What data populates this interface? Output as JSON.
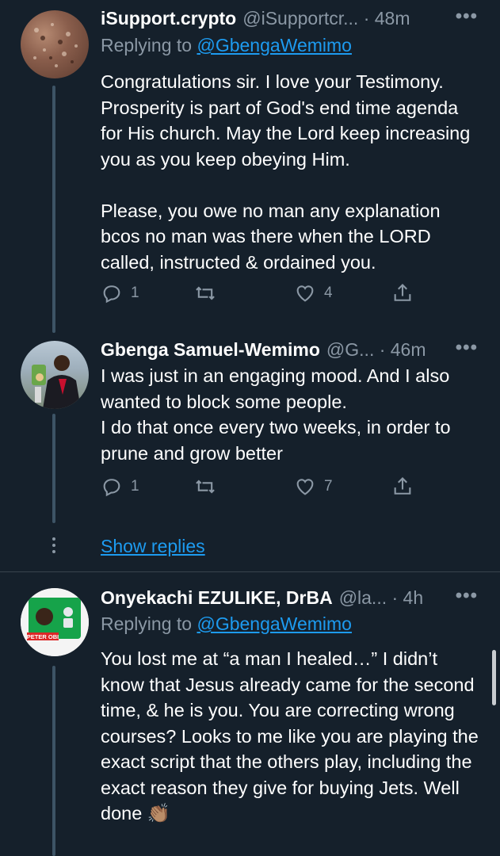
{
  "tweets": [
    {
      "name": "iSupport.crypto",
      "handle": "@iSupportcr... · 48m",
      "more": "•••",
      "replying_prefix": "Replying to ",
      "replying_handle": "@GbengaWemimo",
      "text": "Congratulations sir. I love your Testimony. Prosperity is part of God's end time agenda for His church. May the Lord keep increasing you as you keep obeying Him.\n\nPlease, you owe no man any explanation bcos no man was there when the LORD called, instructed & ordained you.",
      "replies": "1",
      "retweets": "",
      "likes": "4"
    },
    {
      "name": "Gbenga Samuel-Wemimo",
      "handle": "@G... · 46m",
      "more": "•••",
      "text": "I was just in an engaging mood. And I also wanted to block some people.\nI do that once every two weeks, in order to prune and grow better",
      "replies": "1",
      "retweets": "",
      "likes": "7"
    },
    {
      "name": "Onyekachi EZULIKE, DrBA",
      "handle": "@la... · 4h",
      "more": "•••",
      "replying_prefix": "Replying to ",
      "replying_handle": "@GbengaWemimo",
      "text": "You lost me at “a man I healed…” I didn’t know that Jesus already came for the second time, & he is you. You are correcting wrong courses? Looks to me like you are playing the exact script that the others play, including the exact reason they give for buying Jets. Well done 👏🏽",
      "avatar_label": "PETER OBI"
    }
  ],
  "show_replies": "Show replies",
  "colors": {
    "background": "#15202b",
    "link": "#1d9bf0",
    "muted": "#8b98a5",
    "divider": "#38444d"
  }
}
